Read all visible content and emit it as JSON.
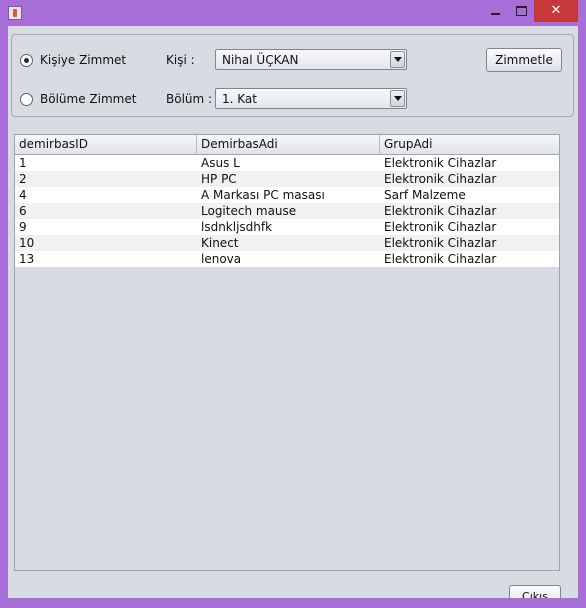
{
  "window": {
    "close_symbol": "✕",
    "icons": [
      "java-cup-icon",
      "minimize-icon",
      "maximize-icon",
      "close-icon"
    ]
  },
  "form": {
    "radio_person": {
      "label": "Kişiye Zimmet",
      "checked": true
    },
    "radio_department": {
      "label": "Bölüme Zimmet",
      "checked": false
    },
    "person_label": "Kişi :",
    "person_value": "Nihal ÜÇKAN",
    "department_label": "Bölüm :",
    "department_value": "1. Kat",
    "assign_button": "Zimmetle"
  },
  "table": {
    "columns": [
      "demirbasID",
      "DemirbasAdi",
      "GrupAdi"
    ],
    "rows": [
      [
        "1",
        "Asus L",
        "Elektronik Cihazlar"
      ],
      [
        "2",
        "HP PC",
        "Elektronik Cihazlar"
      ],
      [
        "4",
        "A Markası PC masası",
        "Sarf Malzeme"
      ],
      [
        "6",
        "Logitech mause",
        "Elektronik Cihazlar"
      ],
      [
        "9",
        "lsdnkljsdhfk",
        "Elektronik Cihazlar"
      ],
      [
        "10",
        "Kinect",
        "Elektronik Cihazlar"
      ],
      [
        "13",
        "lenova",
        "Elektronik Cihazlar"
      ]
    ]
  },
  "footer": {
    "exit_button": "Çıkış"
  }
}
